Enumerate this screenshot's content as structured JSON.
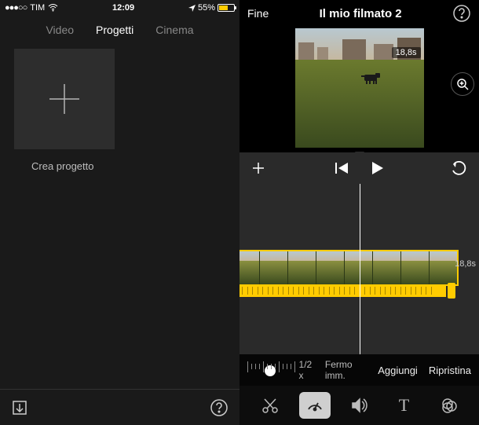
{
  "status": {
    "carrier": "TIM",
    "time": "12:09",
    "battery_pct": "55%"
  },
  "left": {
    "tabs": {
      "video": "Video",
      "progetti": "Progetti",
      "cinema": "Cinema"
    },
    "create_label": "Crea progetto"
  },
  "icons": {
    "export": "export-icon",
    "help": "help-icon"
  },
  "editor": {
    "done": "Fine",
    "title": "Il mio filmato 2",
    "preview_duration": "18,8s",
    "clip_duration": "18,8s"
  },
  "speed": {
    "value": "1/2",
    "suffix": "x",
    "freeze": "Fermo imm.",
    "add": "Aggiungi",
    "reset": "Ripristina"
  }
}
